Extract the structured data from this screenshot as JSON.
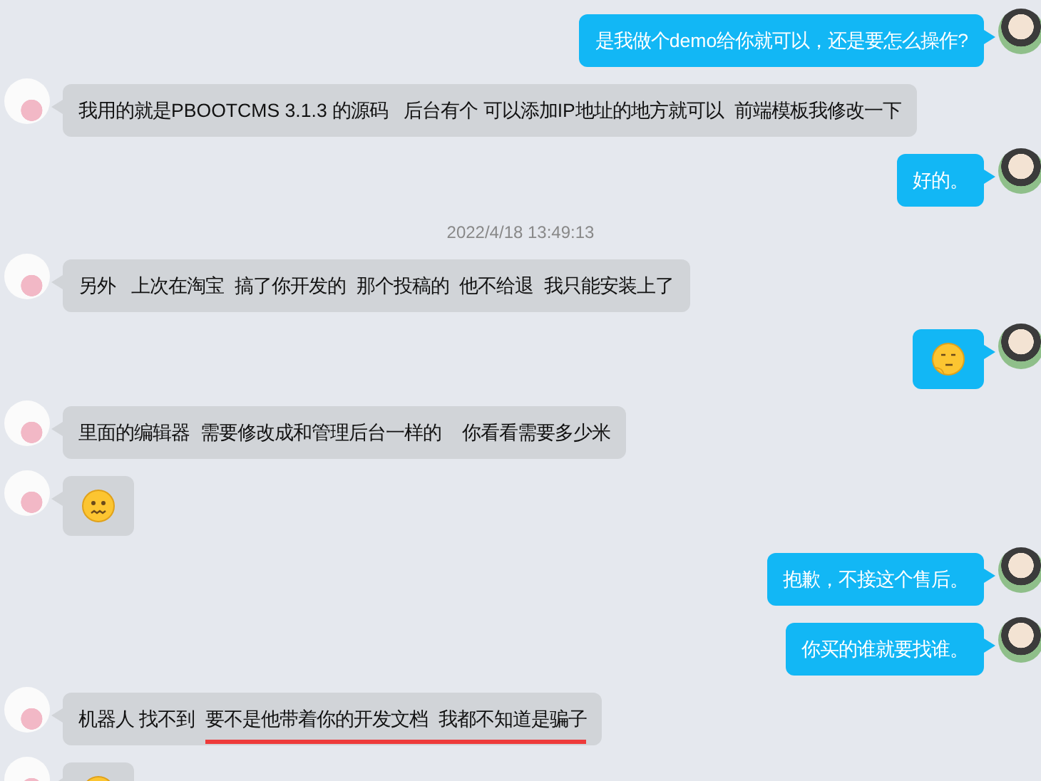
{
  "messages": [
    {
      "kind": "text",
      "outgoing": true,
      "segments": [
        {
          "text": "是我做个demo给你就可以，还是要怎么操作?",
          "underlined": false
        }
      ]
    },
    {
      "kind": "text",
      "outgoing": false,
      "segments": [
        {
          "text": "我用的就是PBOOTCMS 3.1.3 的源码   后台有个 可以添加IP地址的地方就可以  前端模板我修改一下",
          "underlined": false
        }
      ]
    },
    {
      "kind": "text",
      "outgoing": true,
      "segments": [
        {
          "text": "好的。",
          "underlined": false
        }
      ]
    },
    {
      "kind": "time",
      "text": "2022/4/18 13:49:13"
    },
    {
      "kind": "text",
      "outgoing": false,
      "segments": [
        {
          "text": "另外   上次在淘宝  搞了你开发的  那个投稿的  他不给退  我只能安装上了",
          "underlined": false
        }
      ]
    },
    {
      "kind": "emoji",
      "outgoing": true
    },
    {
      "kind": "text",
      "outgoing": false,
      "segments": [
        {
          "text": "里面的编辑器  需要修改成和管理后台一样的    你看看需要多少米",
          "underlined": false
        }
      ]
    },
    {
      "kind": "emoji",
      "outgoing": false
    },
    {
      "kind": "text",
      "outgoing": true,
      "segments": [
        {
          "text": "抱歉，不接这个售后。",
          "underlined": false
        }
      ]
    },
    {
      "kind": "text",
      "outgoing": true,
      "segments": [
        {
          "text": "你买的谁就要找谁。",
          "underlined": false
        }
      ]
    },
    {
      "kind": "text",
      "outgoing": false,
      "segments": [
        {
          "text": "机器人 找不到  ",
          "underlined": false
        },
        {
          "text": "要不是他带着你的开发文档  我都不知道是骗子",
          "underlined": true
        }
      ]
    },
    {
      "kind": "emoji",
      "outgoing": false
    }
  ]
}
